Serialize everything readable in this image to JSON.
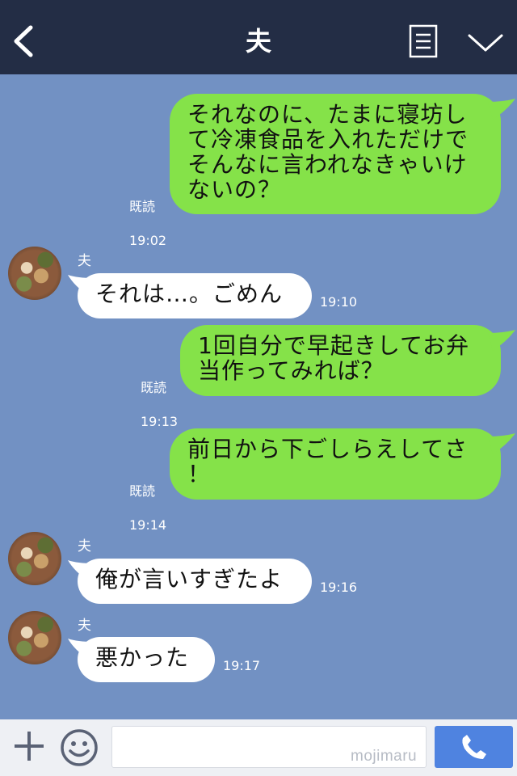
{
  "header": {
    "title": "夫"
  },
  "messages": [
    {
      "type": "sent",
      "text": "それなのに、たまに寝坊し\nて冷凍食品を入れただけで\nそんなに言われなきゃいけ\nないの？",
      "read_label": "既読",
      "time": "19:02"
    },
    {
      "type": "received",
      "sender": "夫",
      "text": "それは…。ごめん",
      "time": "19:10"
    },
    {
      "type": "sent",
      "text": "1回自分で早起きしてお弁\n当作ってみれば？",
      "read_label": "既読",
      "time": "19:13"
    },
    {
      "type": "sent",
      "text": "前日から下ごしらえしてさ\n！",
      "read_label": "既読",
      "time": "19:14"
    },
    {
      "type": "received",
      "sender": "夫",
      "text": "俺が言いすぎたよ",
      "time": "19:16"
    },
    {
      "type": "received",
      "sender": "夫",
      "text": "悪かった",
      "time": "19:17"
    }
  ],
  "input": {
    "value": "",
    "watermark": "mojimaru"
  },
  "colors": {
    "header_bg": "#232d45",
    "chat_bg": "#7291c3",
    "sent_bubble": "#85e249",
    "received_bubble": "#ffffff",
    "call_button": "#4f83e0"
  },
  "icons": [
    "back-icon",
    "notes-icon",
    "chevron-down-icon",
    "plus-icon",
    "smile-icon",
    "phone-icon"
  ]
}
